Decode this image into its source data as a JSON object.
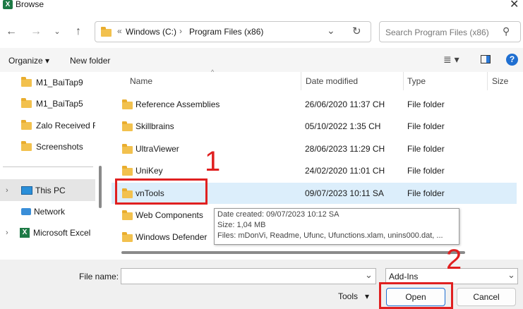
{
  "window": {
    "title": "Browse",
    "app_icon_letter": "X"
  },
  "address": {
    "prefix": "«",
    "segments": [
      "Windows (C:)",
      "Program Files (x86)"
    ],
    "separator": "›"
  },
  "search": {
    "placeholder": "Search Program Files (x86)"
  },
  "toolbar": {
    "organize": "Organize",
    "new_folder": "New folder"
  },
  "sidebar": {
    "items": [
      {
        "label": "M1_BaiTap9",
        "icon": "folder-icon"
      },
      {
        "label": "M1_BaiTap5",
        "icon": "folder-icon"
      },
      {
        "label": "Zalo Received Files",
        "icon": "folder-icon"
      },
      {
        "label": "Screenshots",
        "icon": "folder-icon"
      },
      {
        "label": "This PC",
        "icon": "monitor-icon"
      },
      {
        "label": "Network",
        "icon": "network-icon"
      },
      {
        "label": "Microsoft Excel",
        "icon": "excel-icon"
      }
    ]
  },
  "columns": {
    "name": "Name",
    "date": "Date modified",
    "type": "Type",
    "size": "Size"
  },
  "files": [
    {
      "name": "Reference Assemblies",
      "date": "26/06/2020 11:37 CH",
      "type": "File folder"
    },
    {
      "name": "Skillbrains",
      "date": "05/10/2022 1:35 CH",
      "type": "File folder"
    },
    {
      "name": "UltraViewer",
      "date": "28/06/2023 11:29 CH",
      "type": "File folder"
    },
    {
      "name": "UniKey",
      "date": "24/02/2020 11:01 CH",
      "type": "File folder"
    },
    {
      "name": "vnTools",
      "date": "09/07/2023 10:11 SA",
      "type": "File folder"
    },
    {
      "name": "Web Components",
      "date": "",
      "type": ""
    },
    {
      "name": "Windows Defender",
      "date": "",
      "type": ""
    }
  ],
  "tooltip": {
    "created": "Date created: 09/07/2023 10:12 SA",
    "size": "Size: 1,04 MB",
    "files": "Files: mDonVi, Readme, Ufunc, Ufunctions.xlam, unins000.dat, ..."
  },
  "bottom": {
    "filename_label": "File name:",
    "filename_value": "",
    "filter": "Add-Ins",
    "tools": "Tools",
    "open": "Open",
    "cancel": "Cancel"
  },
  "annotations": {
    "step1": "1",
    "step2": "2"
  },
  "colors": {
    "highlight": "#e02020",
    "selected_row": "#dceefb",
    "folder": "#f2c14e"
  }
}
